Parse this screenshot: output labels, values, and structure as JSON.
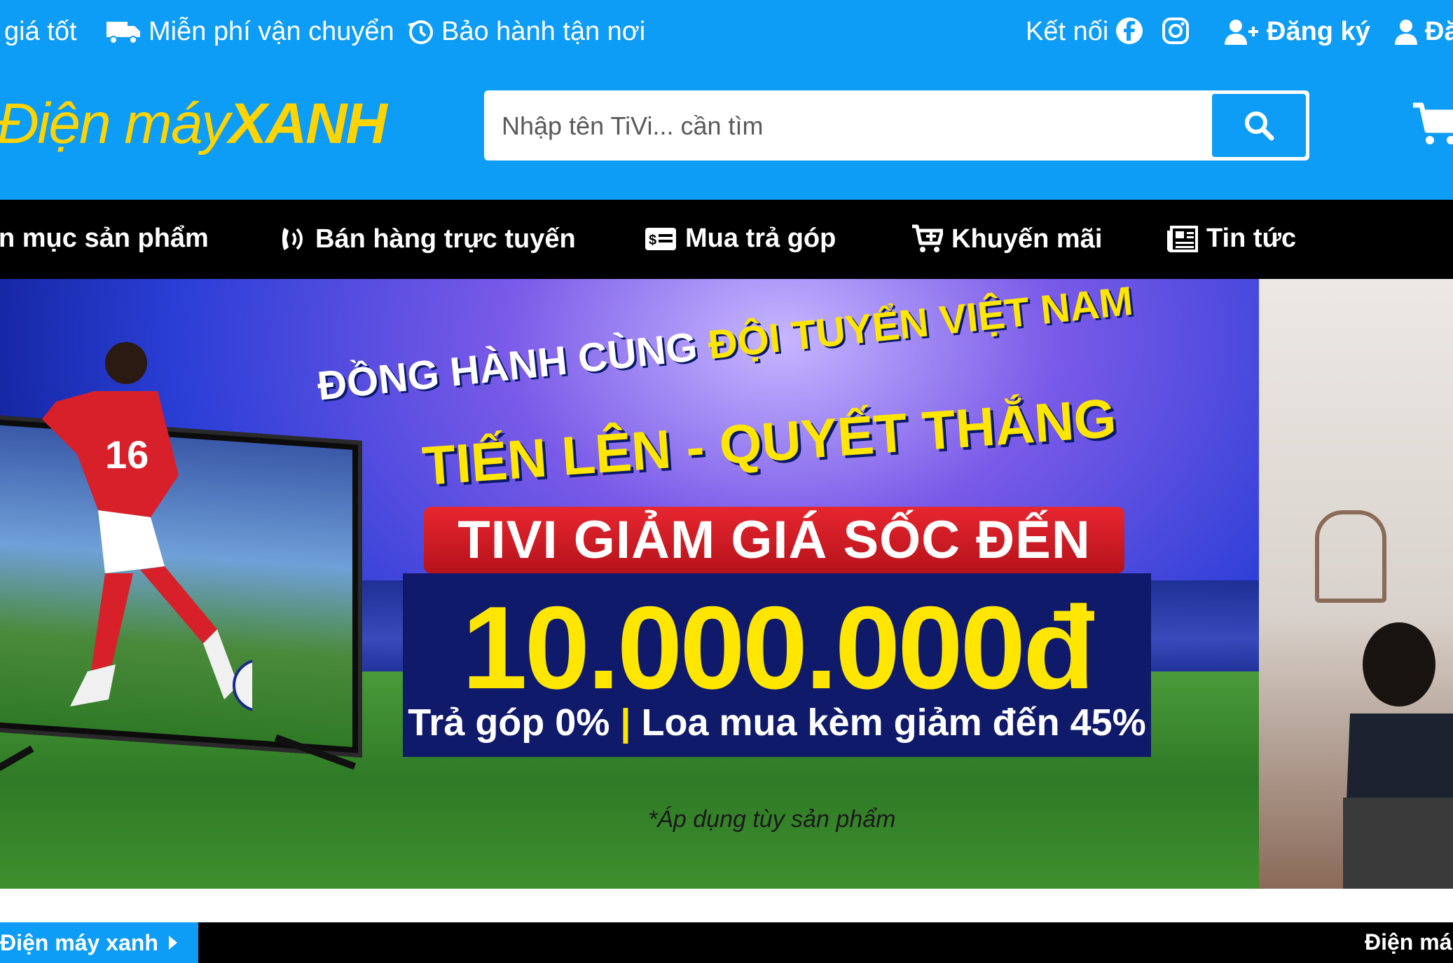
{
  "topbar": {
    "promo1": "giá tốt",
    "promo2": "Miễn phí vận chuyển",
    "promo3": "Bảo hành tận nơi",
    "connect": "Kết nối",
    "register": "Đăng ký",
    "login": "Đă",
    "icons": [
      "truck-icon",
      "history-icon",
      "facebook-icon",
      "instagram-icon",
      "user-plus-icon",
      "user-icon"
    ]
  },
  "header": {
    "logo_part1": "Điện máy",
    "logo_part2": "XANH",
    "search_placeholder": "Nhập tên TiVi... cần tìm",
    "search_icon": "search-icon",
    "cart_icon": "cart-icon"
  },
  "nav": {
    "items": [
      {
        "label": "n mục sản phẩm"
      },
      {
        "label": "Bán hàng trực tuyến",
        "icon": "phone-ringing-icon"
      },
      {
        "label": "Mua trả góp",
        "icon": "card-icon"
      },
      {
        "label": "Khuyến mãi",
        "icon": "cart-plus-icon"
      },
      {
        "label": "Tin tức",
        "icon": "newspaper-icon"
      }
    ]
  },
  "banner": {
    "line1_white": "ĐỒNG HÀNH CÙNG ",
    "line1_yellow": "ĐỘI TUYỂN VIỆT NAM",
    "line2": "TIẾN LÊN - QUYẾT THẮNG",
    "ribbon": "TIVI GIẢM GIÁ SỐC ĐẾN",
    "price": "10.000.000đ",
    "sub_left": "Trả góp 0%",
    "sub_sep": "|",
    "sub_right": "Loa mua kèm giảm đến 45%",
    "note": "*Áp dụng tùy sản phẩm"
  },
  "bottom": {
    "tab": "Điện máy xanh",
    "right": "Điện má"
  },
  "colors": {
    "brand_blue": "#0d9cf6",
    "logo_yellow": "#ffd400",
    "nav_black": "#000000",
    "price_yellow": "#ffe600",
    "ribbon_red": "#d81e26"
  }
}
